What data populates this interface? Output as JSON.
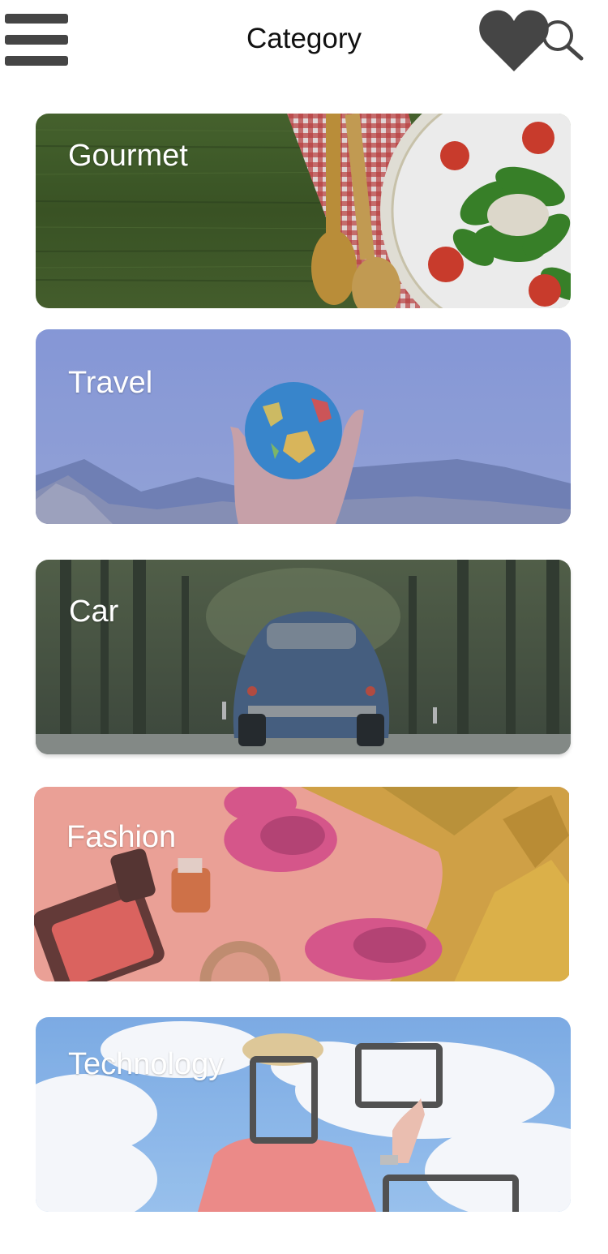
{
  "header": {
    "title": "Category",
    "menu_icon": "hamburger-menu-icon",
    "favorite_icon": "heart-icon",
    "search_icon": "search-icon"
  },
  "categories": [
    {
      "label": "Gourmet",
      "image": "salad-and-wooden-spoons-photo",
      "tint": "#3f5a2b"
    },
    {
      "label": "Travel",
      "image": "hand-holding-globe-photo",
      "tint": "#8193cf"
    },
    {
      "label": "Car",
      "image": "blue-beetle-car-forest-road-photo",
      "tint": "#3c4447"
    },
    {
      "label": "Fashion",
      "image": "tulips-and-makeup-photo",
      "tint": "#e59a90"
    },
    {
      "label": "Technology",
      "image": "man-holding-tablet-frames-sky-photo",
      "tint": "#7aa7dc"
    }
  ],
  "colors": {
    "background": "#ffffff",
    "icon": "#454545",
    "title_text": "#111111",
    "card_label": "#ffffff"
  }
}
